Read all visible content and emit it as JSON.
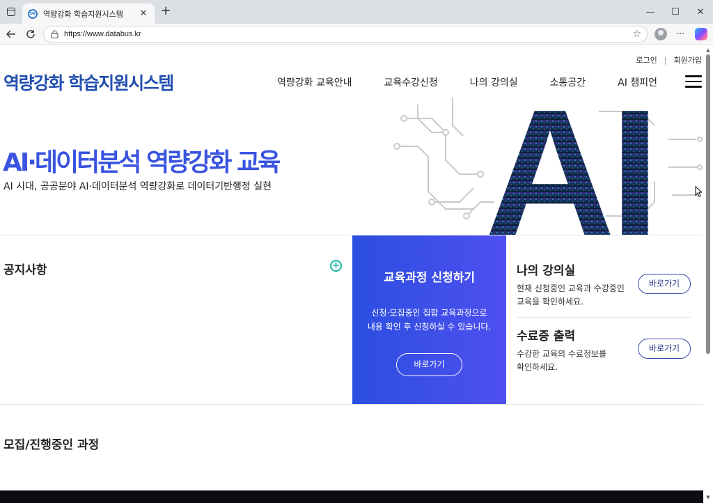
{
  "browser": {
    "tab_title": "역량강화 학습지원시스템",
    "favicon_text": "DB",
    "url": "https://www.databus.kr",
    "new_tab": "+",
    "close_tab": "✕",
    "window_controls": {
      "minimize": "—",
      "maximize": "☐",
      "close": "✕"
    },
    "more": "···"
  },
  "header": {
    "top_links": [
      "로그인",
      "회원가입"
    ],
    "site_title": "역량강화 학습지원시스템",
    "nav": [
      "역량강화 교육안내",
      "교육수강신청",
      "나의 강의실",
      "소통공간",
      "AI 챔피언"
    ]
  },
  "hero": {
    "title": "AI·데이터분석 역량강화 교육",
    "subtitle": "AI 시대, 공공분야 AI·데이터분석 역량강화로 데이터기반행정 실현",
    "art_text": "AI"
  },
  "notice": {
    "title": "공지사항",
    "more": "+"
  },
  "apply": {
    "title": "교육과정 신청하기",
    "desc_line1": "신청·모집중인 집합 교육과정으로",
    "desc_line2": "내용 확인 후 신청하실 수 있습니다.",
    "button": "바로가기"
  },
  "my_class": {
    "title": "나의 강의실",
    "desc_line1": "현재 신청중인 교육과 수강중인",
    "desc_line2": "교육을 확인하세요.",
    "button": "바로가기"
  },
  "certificate": {
    "title": "수료증 출력",
    "desc_line1": "수강한 교육의 수료정보를",
    "desc_line2": "확인하세요.",
    "button": "바로가기"
  },
  "recruit": {
    "title": "모집/진행중인 과정"
  },
  "colors": {
    "brand": "#234fb0",
    "hero": "#3a54e0",
    "apply_bg": "#3b4fe8",
    "accent_teal": "#19b5a5"
  }
}
